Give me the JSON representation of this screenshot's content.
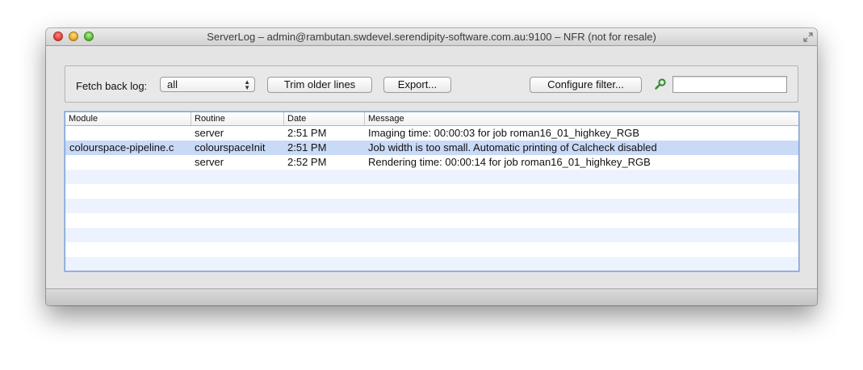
{
  "window": {
    "title": "ServerLog – admin@rambutan.swdevel.serendipity-software.com.au:9100 – NFR (not for resale)"
  },
  "toolbar": {
    "fetch_label": "Fetch back log:",
    "fetch_value": "all",
    "trim_button": "Trim older lines",
    "export_button": "Export...",
    "filter_button": "Configure filter...",
    "search_value": ""
  },
  "table": {
    "columns": [
      "Module",
      "Routine",
      "Date",
      "Message"
    ],
    "rows": [
      {
        "module": "",
        "routine": "server",
        "date": "2:51 PM",
        "message": "Imaging time: 00:00:03 for job roman16_01_highkey_RGB"
      },
      {
        "module": "colourspace-pipeline.c",
        "routine": "colourspaceInit",
        "date": "2:51 PM",
        "message": "Job width is too small. Automatic printing of Calcheck disabled"
      },
      {
        "module": "",
        "routine": "server",
        "date": "2:52 PM",
        "message": "Rendering time: 00:00:14 for job roman16_01_highkey_RGB"
      }
    ],
    "selected_row": 1
  },
  "colors": {
    "selection": "#c9daf7",
    "alt_row": "#edf3fe",
    "search_icon": "#2e8b2e"
  },
  "icons": {
    "search": "search-icon",
    "fullscreen": "fullscreen-icon"
  }
}
